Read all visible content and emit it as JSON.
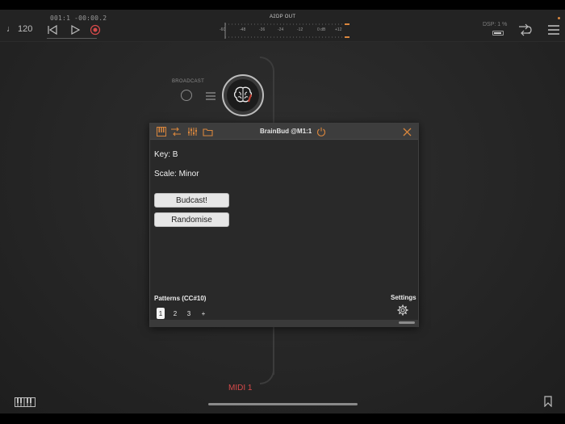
{
  "transport": {
    "tempo": "♩ 120",
    "time": "001:1 -00:00.2"
  },
  "meter": {
    "label": "A2DP OUT",
    "ticks": [
      "-60",
      "-48",
      "-36",
      "-24",
      "-12",
      "0 dB",
      "+12"
    ]
  },
  "status": {
    "dsp": "DSP: 1 %"
  },
  "graph": {
    "broadcast_label": "BROADCAST",
    "midi_label": "MIDI 1"
  },
  "plugin": {
    "title": "BrainBud @M1:1",
    "key": "Key: B",
    "scale": "Scale: Minor",
    "buttons": {
      "budcast": "Budcast!",
      "randomise": "Randomise"
    },
    "patterns_label": "Patterns (CC#10)",
    "settings_label": "Settings",
    "patterns": [
      "1",
      "2",
      "3",
      "+"
    ],
    "active_pattern": "1"
  },
  "colors": {
    "accent": "#d9863d",
    "record": "#d64a4a",
    "midi": "#d64a4a"
  }
}
